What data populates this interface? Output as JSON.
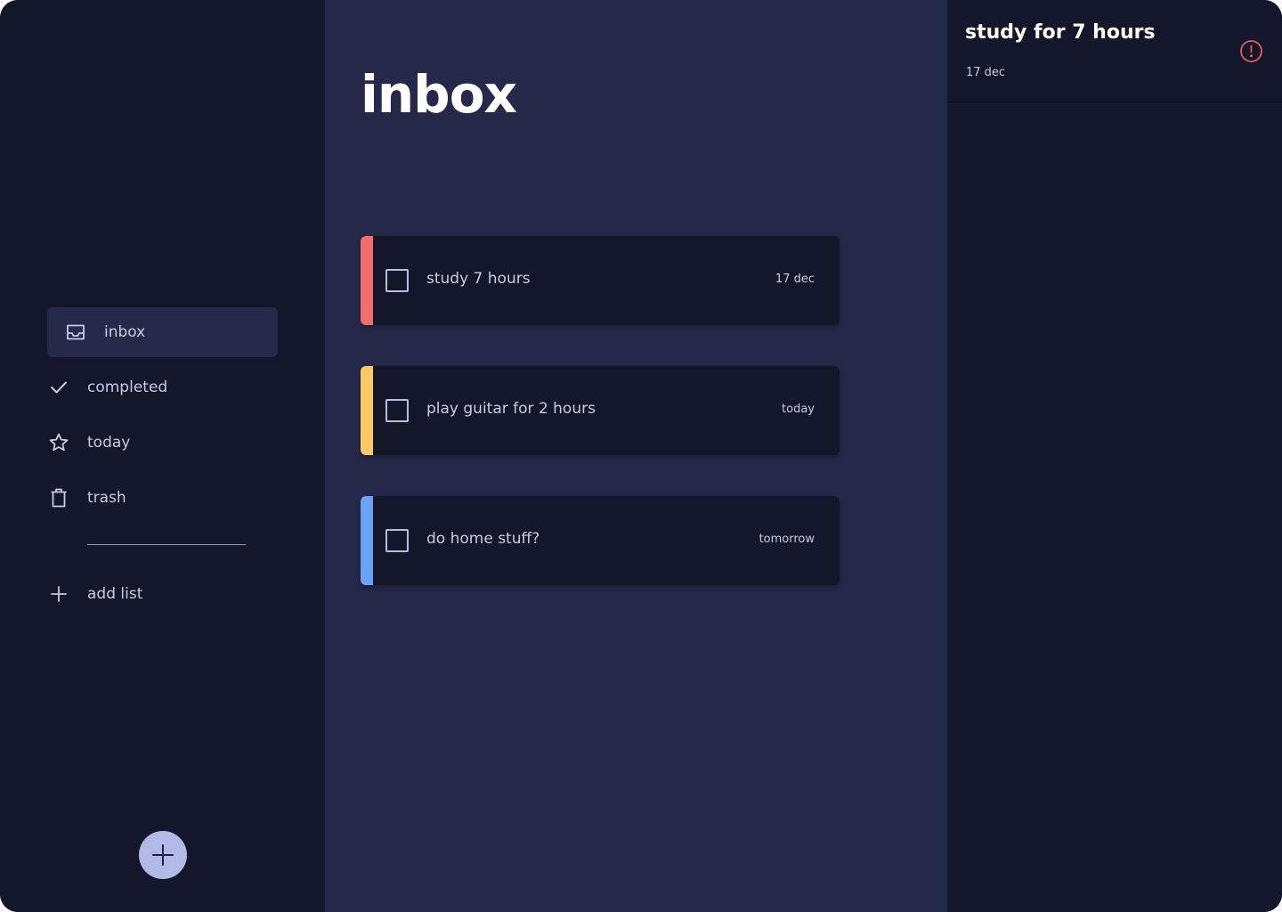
{
  "sidebar": {
    "items": [
      {
        "label": "inbox",
        "icon": "inbox-icon",
        "active": true
      },
      {
        "label": "completed",
        "icon": "check-icon"
      },
      {
        "label": "today",
        "icon": "star-icon"
      },
      {
        "label": "trash",
        "icon": "trash-icon"
      }
    ],
    "add_list_label": "add list"
  },
  "main": {
    "title": "inbox",
    "tasks": [
      {
        "title": "study 7 hours",
        "due": "17 dec",
        "accent": "#f26d6d"
      },
      {
        "title": "play guitar for 2 hours",
        "due": "today",
        "accent": "#fdc965"
      },
      {
        "title": "do home stuff?",
        "due": "tomorrow",
        "accent": "#6aa2f7"
      }
    ]
  },
  "detail": {
    "title": "study for 7 hours",
    "date": "17 dec",
    "alert_icon": "alert-circle-icon",
    "alert_color": "#e35d5d"
  },
  "colors": {
    "sidebar_bg": "#131729",
    "main_bg": "#252848",
    "card_bg": "#131729",
    "text": "#c7cbe4",
    "fab": "#b3b9e6"
  }
}
